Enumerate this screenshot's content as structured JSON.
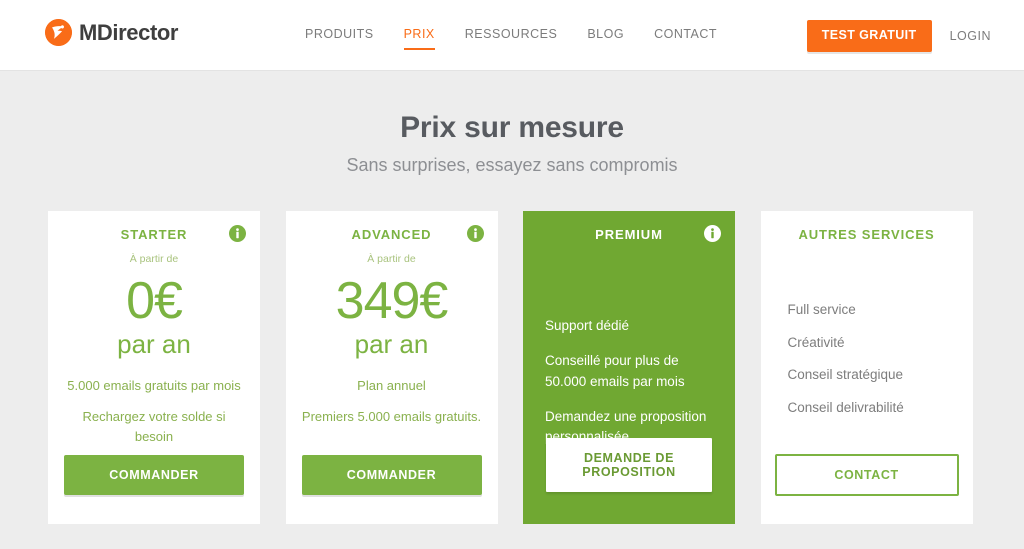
{
  "header": {
    "logo": {
      "icon": "mdirector-bird-logo-icon",
      "text": "MDirector",
      "mark_color": "#f96c18"
    },
    "nav": [
      {
        "label": "PRODUITS",
        "active": false
      },
      {
        "label": "PRIX",
        "active": true
      },
      {
        "label": "RESSOURCES",
        "active": false
      },
      {
        "label": "BLOG",
        "active": false
      },
      {
        "label": "CONTACT",
        "active": false
      }
    ],
    "trial_button": "TEST GRATUIT",
    "login_link": "LOGIN",
    "accent_color": "#f96c18"
  },
  "page": {
    "title": "Prix sur mesure",
    "subtitle": "Sans surprises, essayez sans compromis",
    "background_color": "#ededed"
  },
  "pricing": {
    "accent_green": "#7cb342",
    "featured_green": "#70a832",
    "cards": [
      {
        "id": "starter",
        "title": "STARTER",
        "info_icon": "info-circle-icon",
        "from_label": "À partir de",
        "price": "0€",
        "period": "par an",
        "descriptions": [
          "5.000 emails gratuits par mois",
          "Rechargez votre solde si besoin"
        ],
        "cta": "COMMANDER"
      },
      {
        "id": "advanced",
        "title": "ADVANCED",
        "info_icon": "info-circle-icon",
        "from_label": "À partir de",
        "price": "349€",
        "period": "par an",
        "descriptions": [
          "Plan annuel",
          "Premiers 5.000 emails gratuits."
        ],
        "cta": "COMMANDER"
      },
      {
        "id": "premium",
        "title": "PREMIUM",
        "info_icon": "info-circle-icon",
        "features": [
          "Support dédié",
          "Conseillé pour plus de 50.000 emails par mois",
          "Demandez une proposition personnalisée"
        ],
        "cta": "DEMANDE DE PROPOSITION"
      },
      {
        "id": "autres-services",
        "title": "AUTRES SERVICES",
        "services": [
          "Full service",
          "Créativité",
          "Conseil stratégique",
          "Conseil delivrabilité"
        ],
        "cta": "CONTACT"
      }
    ]
  }
}
